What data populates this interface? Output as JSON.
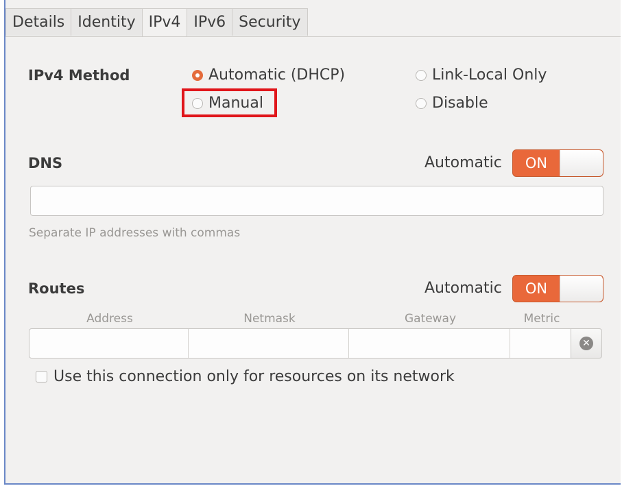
{
  "tabs": [
    "Details",
    "Identity",
    "IPv4",
    "IPv6",
    "Security"
  ],
  "active_tab": "IPv4",
  "ipv4_method": {
    "label": "IPv4 Method",
    "options": {
      "automatic_dhcp": "Automatic (DHCP)",
      "link_local_only": "Link-Local Only",
      "manual": "Manual",
      "disable": "Disable"
    },
    "selected": "Automatic (DHCP)"
  },
  "dns": {
    "label": "DNS",
    "automatic_label": "Automatic",
    "switch_state": "ON",
    "value": "",
    "hint": "Separate IP addresses with commas"
  },
  "routes": {
    "label": "Routes",
    "automatic_label": "Automatic",
    "switch_state": "ON",
    "columns": [
      "Address",
      "Netmask",
      "Gateway",
      "Metric"
    ],
    "row": [
      "",
      "",
      "",
      ""
    ]
  },
  "checkbox": {
    "label": "Use this connection only for resources on its network",
    "checked": false
  },
  "colors": {
    "accent": "#e9683a",
    "highlight": "#e0161b",
    "panel_bg": "#f2f1f0"
  },
  "icons": {
    "delete_route": "clear-circle-icon"
  }
}
